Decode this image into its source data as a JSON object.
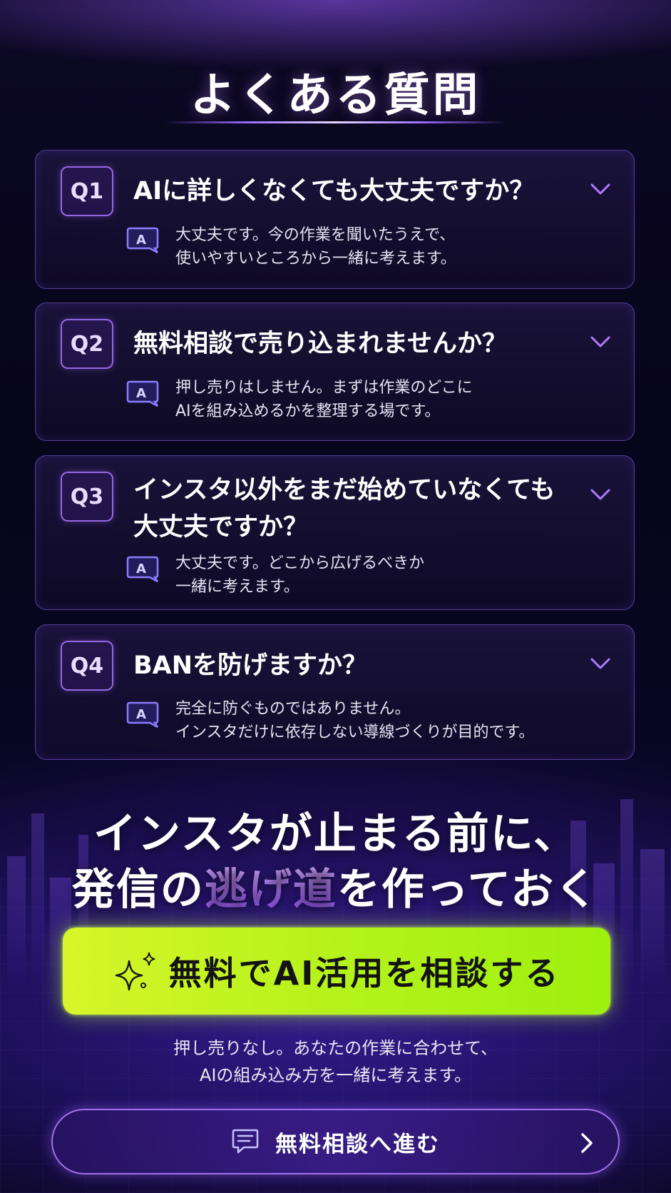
{
  "title": "よくある質問",
  "faq": [
    {
      "q_badge": "Q1",
      "question": "AIに詳しくなくても大丈夫ですか？",
      "a_badge": "A",
      "answer_lines": [
        "大丈夫です。今の作業を聞いたうえで、",
        "使いやすいところから一緒に考えます。"
      ]
    },
    {
      "q_badge": "Q2",
      "question": "無料相談で売り込まれませんか？",
      "a_badge": "A",
      "answer_lines": [
        "押し売りはしません。まずは作業のどこに",
        "AIを組み込めるかを整理する場です。"
      ]
    },
    {
      "q_badge": "Q3",
      "question_lines": [
        "インスタ以外をまだ始めていなくても",
        "大丈夫ですか？"
      ],
      "a_badge": "A",
      "answer_lines": [
        "大丈夫です。どこから広げるべきか",
        "一緒に考えます。"
      ]
    },
    {
      "q_badge": "Q4",
      "question": "BANを防げますか？",
      "a_badge": "A",
      "answer_lines": [
        "完全に防ぐものではありません。",
        "インスタだけに依存しない導線づくりが目的です。"
      ]
    }
  ],
  "headline": {
    "line1": "インスタが止まる前に、",
    "line2_pre": "発信の",
    "line2_accent": "逃げ道",
    "line2_post": "を作っておく"
  },
  "cta": {
    "label": "無料でAI活用を相談する",
    "icon": "sparkle-icon"
  },
  "sub_lines": [
    "押し売りなし。あなたの作業に合わせて、",
    "AIの組み込み方を一緒に考えます。"
  ],
  "secondary_button": {
    "label": "無料相談へ進む",
    "icon": "chat-icon",
    "arrow": "chevron-right-icon"
  },
  "colors": {
    "accent_purple": "#a66bff",
    "cta_green": "#b5f21c",
    "background": "#08051a"
  }
}
